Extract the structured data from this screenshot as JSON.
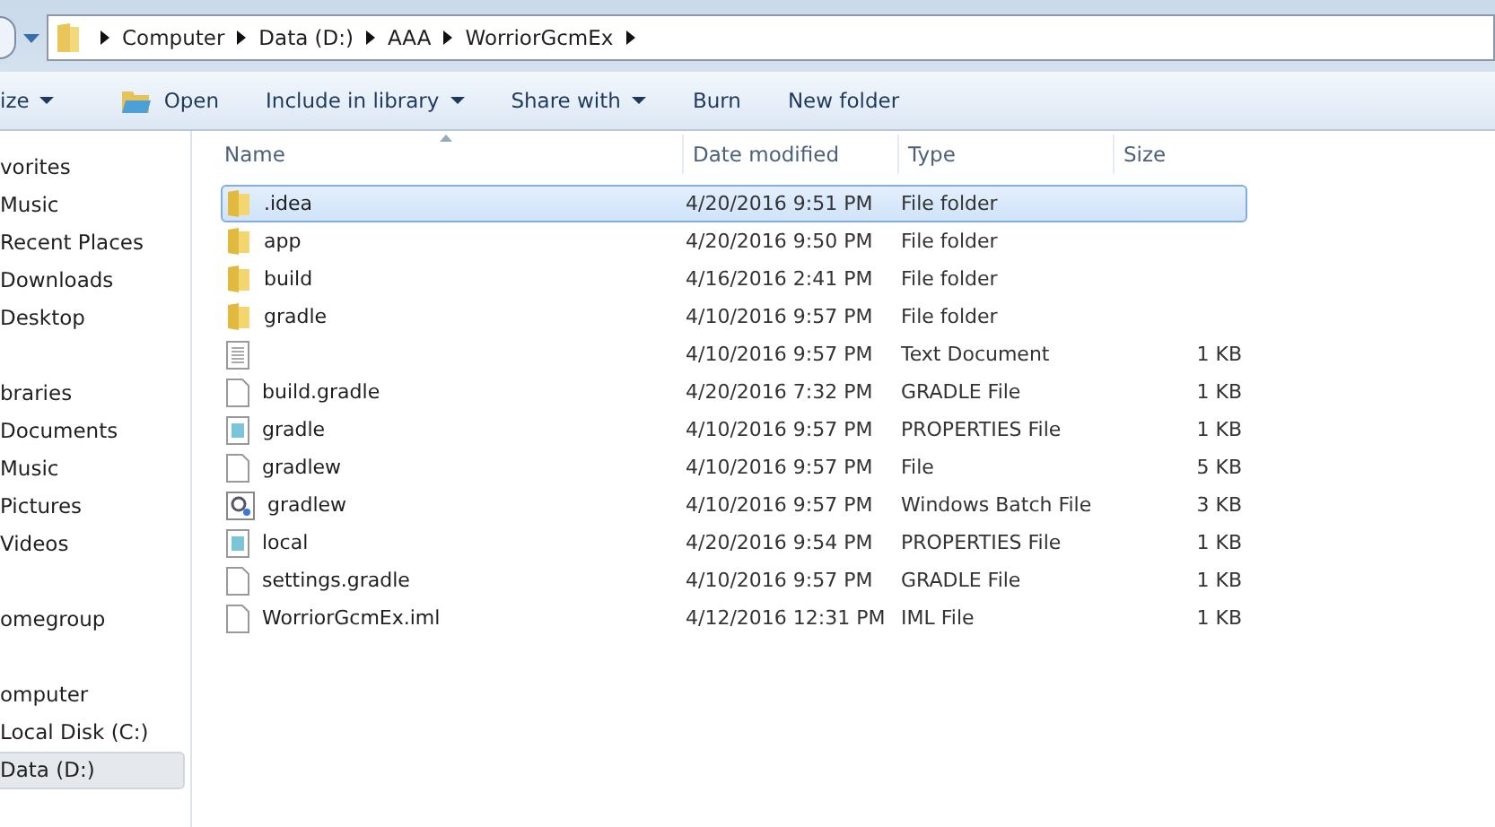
{
  "address_bar": {
    "segments": [
      "Computer",
      "Data (D:)",
      "AAA",
      "WorriorGcmEx"
    ]
  },
  "toolbar": [
    {
      "label": "ize",
      "kind": "menu"
    },
    {
      "label": "Open",
      "kind": "open"
    },
    {
      "label": "Include in library",
      "kind": "menu"
    },
    {
      "label": "Share with",
      "kind": "menu"
    },
    {
      "label": "Burn",
      "kind": "plain"
    },
    {
      "label": "New folder",
      "kind": "plain"
    }
  ],
  "sidebar": {
    "groups": [
      {
        "label": "vorites",
        "children": [
          {
            "label": "Music",
            "selected": false
          },
          {
            "label": "Recent Places",
            "selected": false
          },
          {
            "label": "Downloads",
            "selected": false
          },
          {
            "label": "Desktop",
            "selected": false
          }
        ]
      },
      {
        "label": "braries",
        "children": [
          {
            "label": "Documents",
            "selected": false
          },
          {
            "label": "Music",
            "selected": false
          },
          {
            "label": "Pictures",
            "selected": false
          },
          {
            "label": "Videos",
            "selected": false
          }
        ]
      },
      {
        "label": "omegroup"
      },
      {
        "label": "omputer",
        "children": [
          {
            "label": "Local Disk (C:)",
            "selected": false
          },
          {
            "label": "Data (D:)",
            "selected": true
          }
        ]
      }
    ]
  },
  "table": {
    "columns": [
      "Name",
      "Date modified",
      "Type",
      "Size"
    ],
    "rows": [
      {
        "name": ".idea",
        "date": "4/20/2016 9:51 PM",
        "type": "File folder",
        "kind": "folder",
        "selected": true
      },
      {
        "name": "app",
        "date": "4/20/2016 9:50 PM",
        "type": "File folder",
        "kind": "folder",
        "selected": false
      },
      {
        "name": "build",
        "date": "4/16/2016 2:41 PM",
        "type": "File folder",
        "kind": "folder",
        "selected": false
      },
      {
        "name": "gradle",
        "date": "4/10/2016 9:57 PM",
        "type": "File folder",
        "kind": "folder",
        "selected": false
      },
      {
        "date": "4/10/2016 9:57 PM",
        "type": "Text Document",
        "size": "1 KB",
        "kind": "text",
        "selected": false
      },
      {
        "name": "build.gradle",
        "date": "4/20/2016 7:32 PM",
        "type": "GRADLE File",
        "size": "1 KB",
        "kind": "blank",
        "selected": false
      },
      {
        "name": "gradle",
        "date": "4/10/2016 9:57 PM",
        "type": "PROPERTIES File",
        "size": "1 KB",
        "kind": "properties",
        "selected": false
      },
      {
        "name": "gradlew",
        "date": "4/10/2016 9:57 PM",
        "type": "File",
        "size": "5 KB",
        "kind": "blank",
        "selected": false
      },
      {
        "name": "gradlew",
        "date": "4/10/2016 9:57 PM",
        "type": "Windows Batch File",
        "size": "3 KB",
        "kind": "batch",
        "selected": false
      },
      {
        "name": "local",
        "date": "4/20/2016 9:54 PM",
        "type": "PROPERTIES File",
        "size": "1 KB",
        "kind": "properties",
        "selected": false
      },
      {
        "name": "settings.gradle",
        "date": "4/10/2016 9:57 PM",
        "type": "GRADLE File",
        "size": "1 KB",
        "kind": "blank",
        "selected": false
      },
      {
        "name": "WorriorGcmEx.iml",
        "date": "4/12/2016 12:31 PM",
        "type": "IML File",
        "size": "1 KB",
        "kind": "blank",
        "selected": false
      }
    ]
  }
}
